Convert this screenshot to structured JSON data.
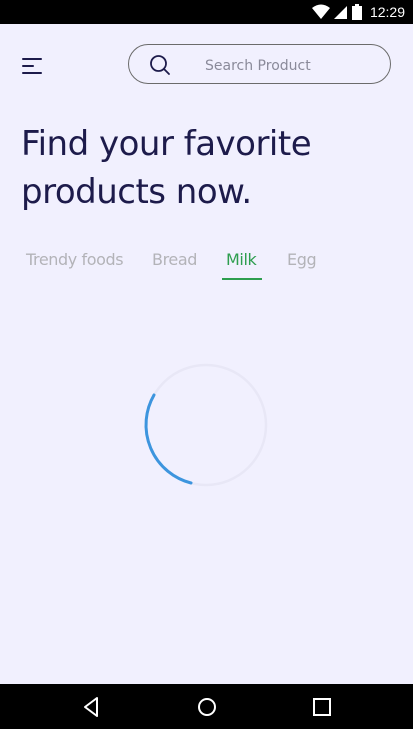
{
  "status_bar": {
    "time": "12:29",
    "icons": [
      "wifi-icon",
      "cell-signal-icon",
      "battery-icon"
    ]
  },
  "header": {
    "menu_icon": "hamburger-menu-icon",
    "search": {
      "placeholder": "Search Product",
      "value": "",
      "icon": "search-icon"
    }
  },
  "headline": {
    "line1": "Find your favorite",
    "line2": "products now."
  },
  "tabs": [
    {
      "label": "Trendy foods",
      "active": false
    },
    {
      "label": "Bread",
      "active": false
    },
    {
      "label": "Milk",
      "active": true
    },
    {
      "label": "Egg",
      "active": false
    }
  ],
  "loading": {
    "spinner_icon": "loading-spinner-icon"
  },
  "nav_bar": {
    "icons": [
      "back-icon",
      "home-icon",
      "recents-icon"
    ]
  },
  "colors": {
    "background": "#f1f0fe",
    "text_dark": "#1d1b4b",
    "tab_inactive": "#b3b3b8",
    "accent_green": "#2e9e4f",
    "spinner_blue": "#3d95de"
  }
}
